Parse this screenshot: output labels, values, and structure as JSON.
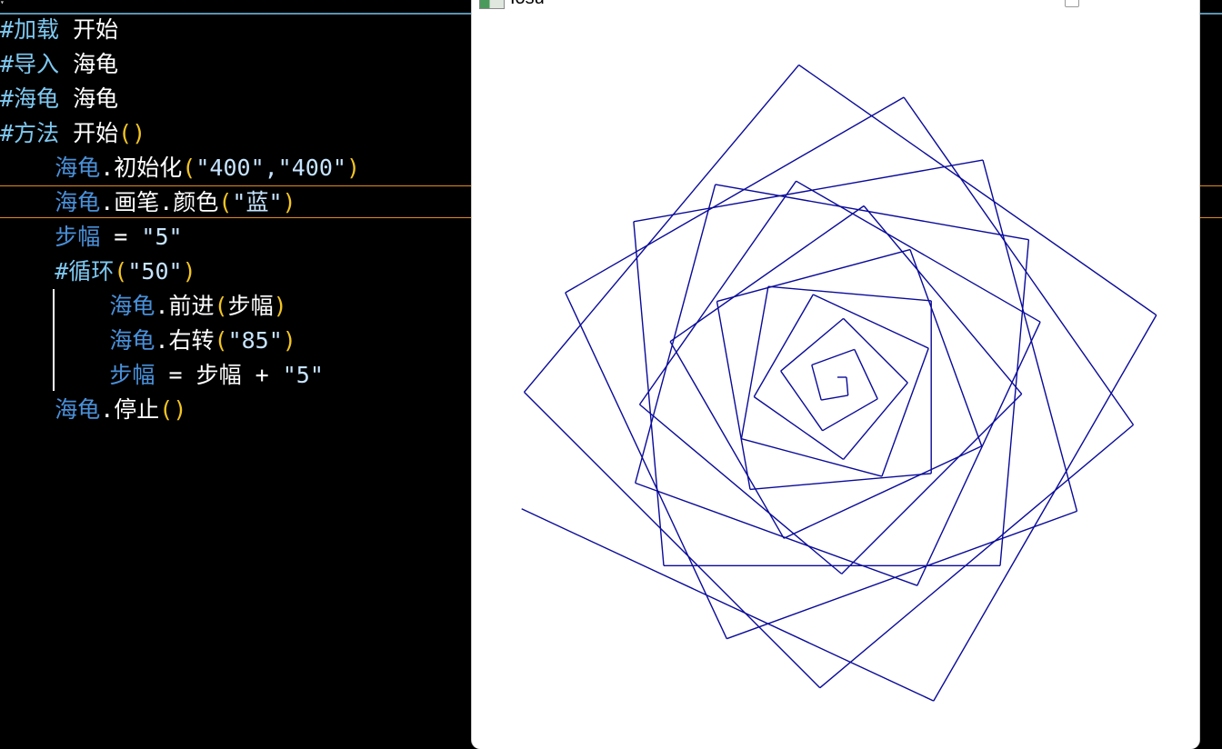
{
  "editor": {
    "lines": [
      {
        "tokens": [
          {
            "cls": "kw",
            "text": "#加载"
          },
          {
            "cls": "w",
            "text": " 开始"
          }
        ]
      },
      {
        "tokens": [
          {
            "cls": "kw",
            "text": "#导入"
          },
          {
            "cls": "w",
            "text": " 海龟"
          }
        ]
      },
      {
        "tokens": [
          {
            "cls": "kw",
            "text": "#海龟"
          },
          {
            "cls": "w",
            "text": " 海龟"
          }
        ]
      },
      {
        "tokens": [
          {
            "cls": "kw",
            "text": "#方法"
          },
          {
            "cls": "w",
            "text": " 开始"
          },
          {
            "cls": "par",
            "text": "()"
          }
        ]
      },
      {
        "tokens": [
          {
            "cls": "w",
            "text": "    "
          },
          {
            "cls": "id",
            "text": "海龟"
          },
          {
            "cls": "w",
            "text": ".初始化"
          },
          {
            "cls": "par",
            "text": "("
          },
          {
            "cls": "str",
            "text": "\"400\",\"400\""
          },
          {
            "cls": "par",
            "text": ")"
          }
        ]
      },
      {
        "tokens": [
          {
            "cls": "w",
            "text": "    "
          },
          {
            "cls": "id",
            "text": "海龟"
          },
          {
            "cls": "w",
            "text": ".画笔.颜色"
          },
          {
            "cls": "par",
            "text": "("
          },
          {
            "cls": "str",
            "text": "\"蓝\""
          },
          {
            "cls": "par",
            "text": ")"
          }
        ]
      },
      {
        "tokens": [
          {
            "cls": "w",
            "text": "    "
          },
          {
            "cls": "id",
            "text": "步幅"
          },
          {
            "cls": "w",
            "text": " = "
          },
          {
            "cls": "str",
            "text": "\"5\""
          }
        ]
      },
      {
        "tokens": [
          {
            "cls": "w",
            "text": "    "
          },
          {
            "cls": "kw",
            "text": "#循环"
          },
          {
            "cls": "par",
            "text": "("
          },
          {
            "cls": "str",
            "text": "\"50\""
          },
          {
            "cls": "par",
            "text": ")"
          }
        ]
      },
      {
        "tokens": [
          {
            "cls": "w",
            "text": "        "
          },
          {
            "cls": "id",
            "text": "海龟"
          },
          {
            "cls": "w",
            "text": ".前进"
          },
          {
            "cls": "par",
            "text": "("
          },
          {
            "cls": "w",
            "text": "步幅"
          },
          {
            "cls": "par",
            "text": ")"
          }
        ]
      },
      {
        "tokens": [
          {
            "cls": "w",
            "text": "        "
          },
          {
            "cls": "id",
            "text": "海龟"
          },
          {
            "cls": "w",
            "text": ".右转"
          },
          {
            "cls": "par",
            "text": "("
          },
          {
            "cls": "str",
            "text": "\"85\""
          },
          {
            "cls": "par",
            "text": ")"
          }
        ]
      },
      {
        "tokens": [
          {
            "cls": "w",
            "text": "        "
          },
          {
            "cls": "id",
            "text": "步幅"
          },
          {
            "cls": "w",
            "text": " = 步幅 + "
          },
          {
            "cls": "str",
            "text": "\"5\""
          }
        ]
      },
      {
        "tokens": [
          {
            "cls": "w",
            "text": "    "
          },
          {
            "cls": "id",
            "text": "海龟"
          },
          {
            "cls": "w",
            "text": ".停止"
          },
          {
            "cls": "par",
            "text": "()"
          }
        ]
      }
    ]
  },
  "turtle_window": {
    "title": "Iosu",
    "icon": "turtle-app-icon",
    "pen_color": "#0a0a9a",
    "drawing": {
      "steps": 50,
      "step_start": 5,
      "step_increment": 5,
      "turn_right_degrees": 85
    }
  }
}
